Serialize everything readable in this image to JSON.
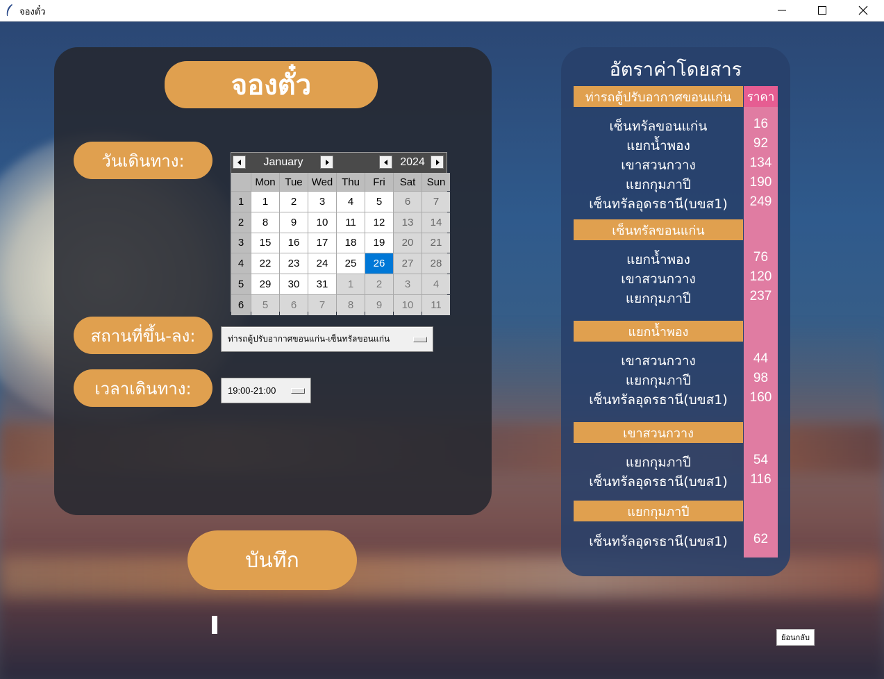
{
  "window": {
    "title": "จองตั๋ว"
  },
  "header": {
    "title": "จองตั๋ว"
  },
  "form": {
    "date_label": "วันเดินทาง:",
    "place_label": "สถานที่ขึ้น-ลง:",
    "time_label": "เวลาเดินทาง:",
    "route_value": "ท่ารถตู้ปรับอากาศขอนแก่น-เซ็นทรัลขอนแก่น",
    "time_value": "19:00-21:00",
    "save_label": "บันทึก"
  },
  "calendar": {
    "month": "January",
    "year": "2024",
    "days_of_week": [
      "Mon",
      "Tue",
      "Wed",
      "Thu",
      "Fri",
      "Sat",
      "Sun"
    ],
    "weeks": [
      {
        "num": "1",
        "days": [
          "1",
          "2",
          "3",
          "4",
          "5",
          "6",
          "7"
        ]
      },
      {
        "num": "2",
        "days": [
          "8",
          "9",
          "10",
          "11",
          "12",
          "13",
          "14"
        ]
      },
      {
        "num": "3",
        "days": [
          "15",
          "16",
          "17",
          "18",
          "19",
          "20",
          "21"
        ]
      },
      {
        "num": "4",
        "days": [
          "22",
          "23",
          "24",
          "25",
          "26",
          "27",
          "28"
        ]
      },
      {
        "num": "5",
        "days": [
          "29",
          "30",
          "31",
          "1",
          "2",
          "3",
          "4"
        ]
      },
      {
        "num": "6",
        "days": [
          "5",
          "6",
          "7",
          "8",
          "9",
          "10",
          "11"
        ]
      }
    ],
    "selected_day": "26"
  },
  "fares": {
    "title": "อัตราค่าโดยสาร",
    "price_header": "ราคา",
    "groups": [
      {
        "origin": "ท่ารถตู้ปรับอากาศขอนแก่น",
        "rows": [
          {
            "dest": "เซ็นทรัลขอนแก่น",
            "price": "16"
          },
          {
            "dest": "แยกน้ำพอง",
            "price": "92"
          },
          {
            "dest": "เขาสวนกวาง",
            "price": "134"
          },
          {
            "dest": "แยกกุมภาปี",
            "price": "190"
          },
          {
            "dest": "เซ็นทรัลอุดรธานี(บขส1)",
            "price": "249"
          }
        ]
      },
      {
        "origin": "เซ็นทรัลขอนแก่น",
        "rows": [
          {
            "dest": "แยกน้ำพอง",
            "price": "76"
          },
          {
            "dest": "เขาสวนกวาง",
            "price": "120"
          },
          {
            "dest": "แยกกุมภาปี",
            "price": "237"
          }
        ]
      },
      {
        "origin": "แยกน้ำพอง",
        "rows": [
          {
            "dest": "เขาสวนกวาง",
            "price": "44"
          },
          {
            "dest": "แยกกุมภาปี",
            "price": "98"
          },
          {
            "dest": "เซ็นทรัลอุดรธานี(บขส1)",
            "price": "160"
          }
        ]
      },
      {
        "origin": "เขาสวนกวาง",
        "rows": [
          {
            "dest": "แยกกุมภาปี",
            "price": "54"
          },
          {
            "dest": "เซ็นทรัลอุดรธานี(บขส1)",
            "price": "116"
          }
        ]
      },
      {
        "origin": "แยกกุมภาปี",
        "rows": [
          {
            "dest": "เซ็นทรัลอุดรธานี(บขส1)",
            "price": "62"
          }
        ]
      }
    ]
  },
  "back_label": "ย้อนกลับ",
  "colors": {
    "accent": "#e0a04f",
    "price_col": "#e07ca2",
    "price_head": "#e65d92",
    "selected": "#0078d7"
  }
}
